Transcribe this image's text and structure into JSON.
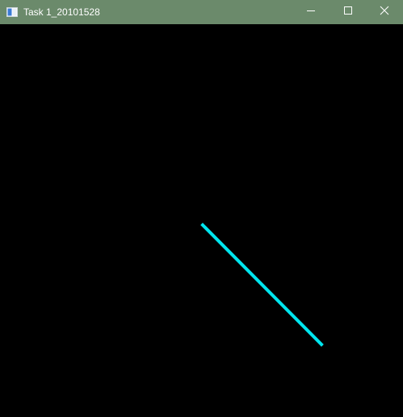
{
  "window": {
    "title": "Task 1_20101528",
    "titlebar_color": "#6b8a6b",
    "background_color": "#000000"
  },
  "titlebar_buttons": {
    "minimize_icon": "minimize-icon",
    "maximize_icon": "maximize-icon",
    "close_icon": "close-icon"
  },
  "drawing": {
    "line_color": "#00e5ee"
  }
}
